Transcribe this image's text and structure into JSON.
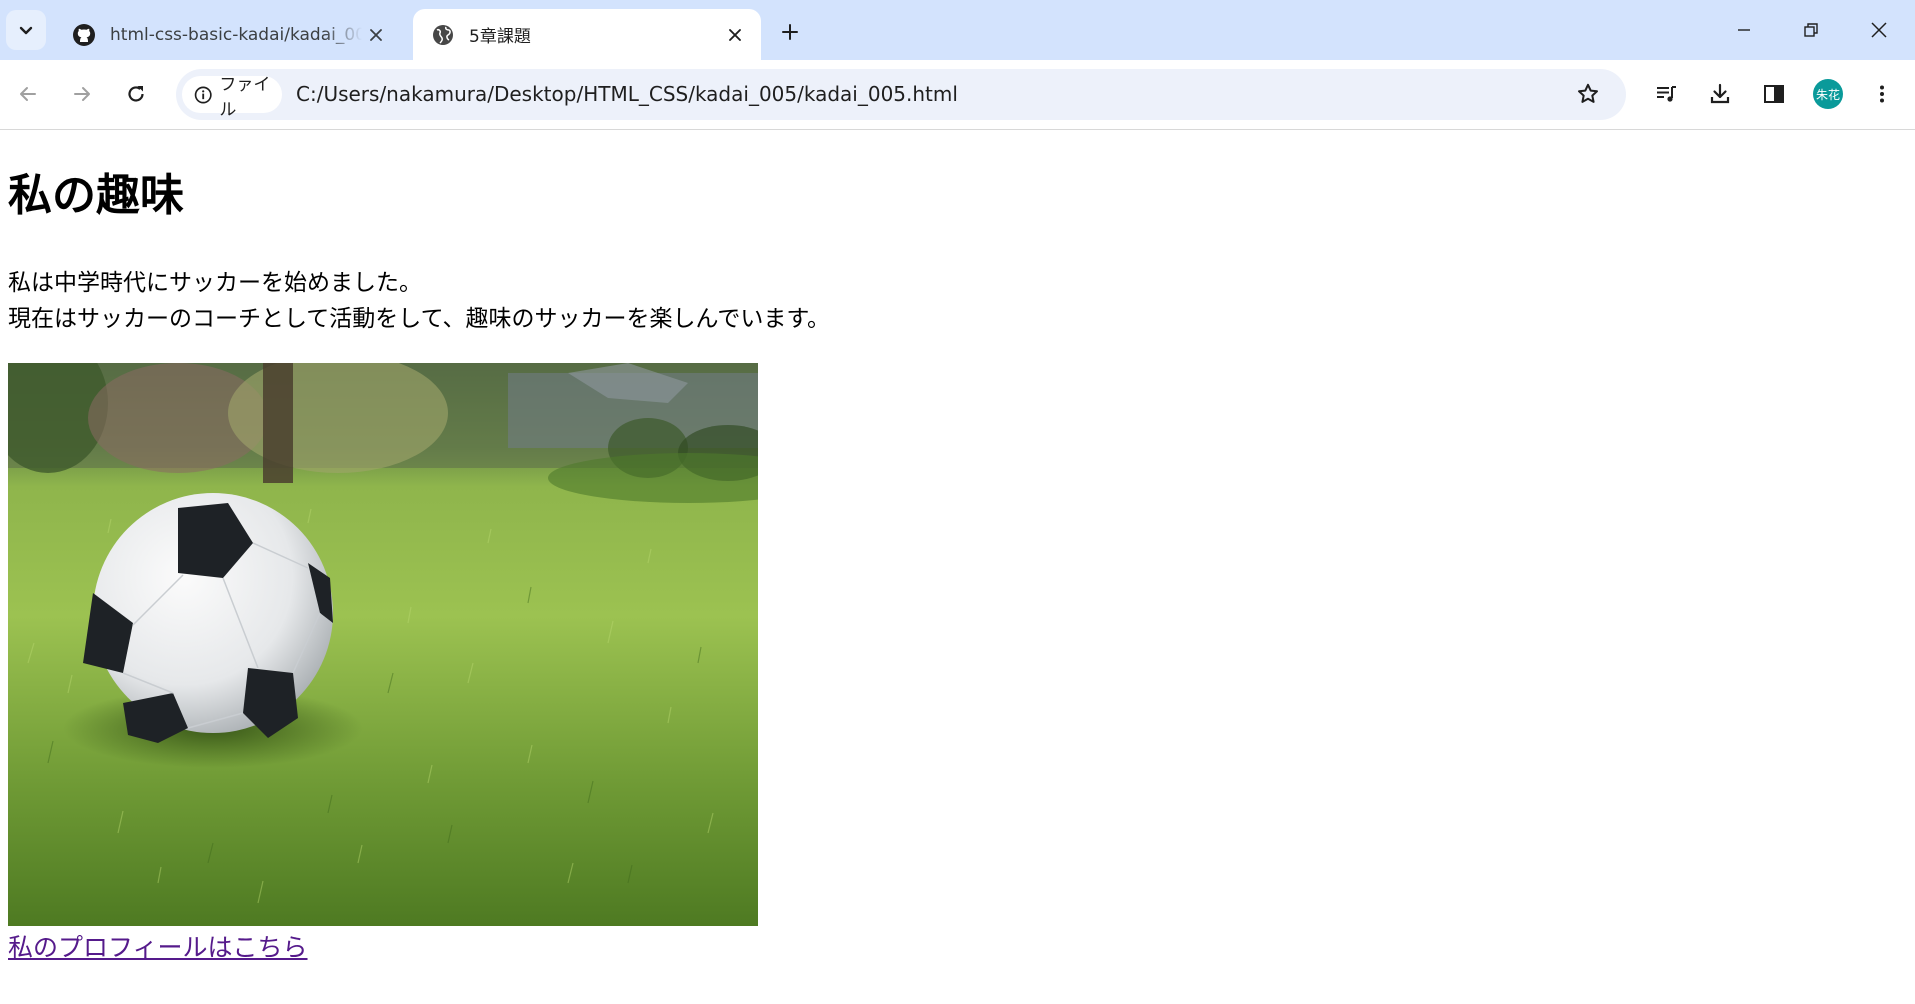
{
  "browser": {
    "tabs": [
      {
        "title": "html-css-basic-kadai/kadai_005",
        "icon": "github-icon",
        "active": false
      },
      {
        "title": "5章課題",
        "icon": "globe-icon",
        "active": true
      }
    ],
    "address_bar": {
      "security_chip_label": "ファイル",
      "url": "C:/Users/nakamura/Desktop/HTML_CSS/kadai_005/kadai_005.html"
    },
    "profile_avatar_text": "朱花",
    "colors": {
      "tabstrip_bg": "#d3e3fd",
      "omnibox_bg": "#edf1fa",
      "avatar_bg": "#0a9a9a"
    }
  },
  "page": {
    "heading": "私の趣味",
    "paragraph_lines": [
      "私は中学時代にサッカーを始めました。",
      "現在はサッカーのコーチとして活動をして、趣味のサッカーを楽しんでいます。"
    ],
    "image_subject": "soccer ball on grass",
    "link_text": "私のプロフィールはこちら",
    "link_color": "#551a8b"
  }
}
